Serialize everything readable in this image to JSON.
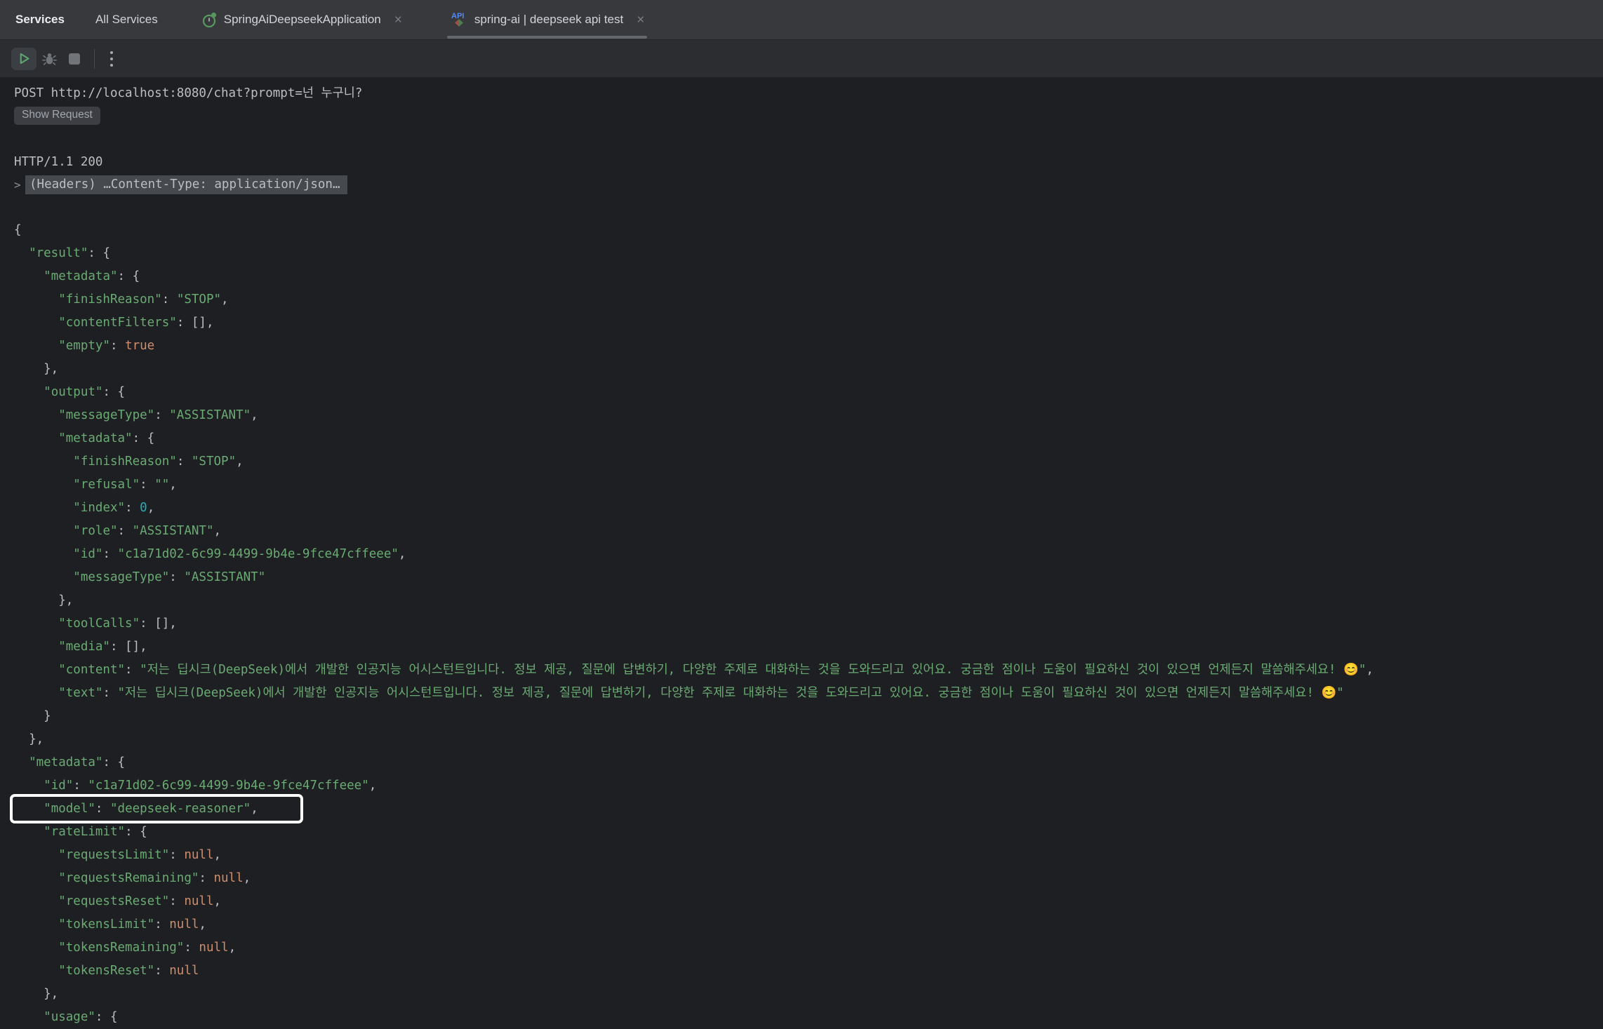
{
  "tabbar": {
    "tool_label": "Services",
    "all_services_label": "All Services",
    "tabs": [
      {
        "label": "SpringAiDeepseekApplication",
        "icon": "spring-boot-run-icon",
        "close_glyph": "×"
      },
      {
        "label": "spring-ai | deepseek api test",
        "icon": "http-client-api-icon",
        "close_glyph": "×",
        "active": true
      }
    ]
  },
  "toolbar": {
    "icons": [
      "run-icon",
      "debug-icon",
      "stop-icon",
      "kebab-menu-icon"
    ],
    "run_color": "#5CA570",
    "disabled_color": "#717478"
  },
  "console": {
    "request_line": "POST http://localhost:8080/chat?prompt=넌 누구니?",
    "show_request_label": "Show Request",
    "status_line": "HTTP/1.1 200",
    "fold_chevron": ">",
    "headers_fold": "(Headers) …Content-Type: application/json…"
  },
  "response_json": {
    "boxed_line_index": 25,
    "lines": [
      "{",
      "  \"result\": {",
      "    \"metadata\": {",
      "      \"finishReason\": \"STOP\",",
      "      \"contentFilters\": [],",
      "      \"empty\": true",
      "    },",
      "    \"output\": {",
      "      \"messageType\": \"ASSISTANT\",",
      "      \"metadata\": {",
      "        \"finishReason\": \"STOP\",",
      "        \"refusal\": \"\",",
      "        \"index\": 0,",
      "        \"role\": \"ASSISTANT\",",
      "        \"id\": \"c1a71d02-6c99-4499-9b4e-9fce47cffeee\",",
      "        \"messageType\": \"ASSISTANT\"",
      "      },",
      "      \"toolCalls\": [],",
      "      \"media\": [],",
      "      \"content\": \"저는 딥시크(DeepSeek)에서 개발한 인공지능 어시스턴트입니다. 정보 제공, 질문에 답변하기, 다양한 주제로 대화하는 것을 도와드리고 있어요. 궁금한 점이나 도움이 필요하신 것이 있으면 언제든지 말씀해주세요! 😊\",",
      "      \"text\": \"저는 딥시크(DeepSeek)에서 개발한 인공지능 어시스턴트입니다. 정보 제공, 질문에 답변하기, 다양한 주제로 대화하는 것을 도와드리고 있어요. 궁금한 점이나 도움이 필요하신 것이 있으면 언제든지 말씀해주세요! 😊\"",
      "    }",
      "  },",
      "  \"metadata\": {",
      "    \"id\": \"c1a71d02-6c99-4499-9b4e-9fce47cffeee\",",
      "    \"model\": \"deepseek-reasoner\",",
      "    \"rateLimit\": {",
      "      \"requestsLimit\": null,",
      "      \"requestsRemaining\": null,",
      "      \"requestsReset\": null,",
      "      \"tokensLimit\": null,",
      "      \"tokensRemaining\": null,",
      "      \"tokensReset\": null",
      "    },",
      "    \"usage\": {"
    ]
  },
  "colors": {
    "background": "#1E1F22",
    "tabbar_bg": "#37393D",
    "toolbar_bg": "#2B2D31",
    "json_string": "#6AAB73",
    "json_keyword": "#CF8E6D",
    "json_number": "#2AACB8",
    "json_punct": "#BCBEC4",
    "fold_bg": "#46494D",
    "highlight_box": "#FFFFFF",
    "active_tab_underline": "#63666B"
  }
}
